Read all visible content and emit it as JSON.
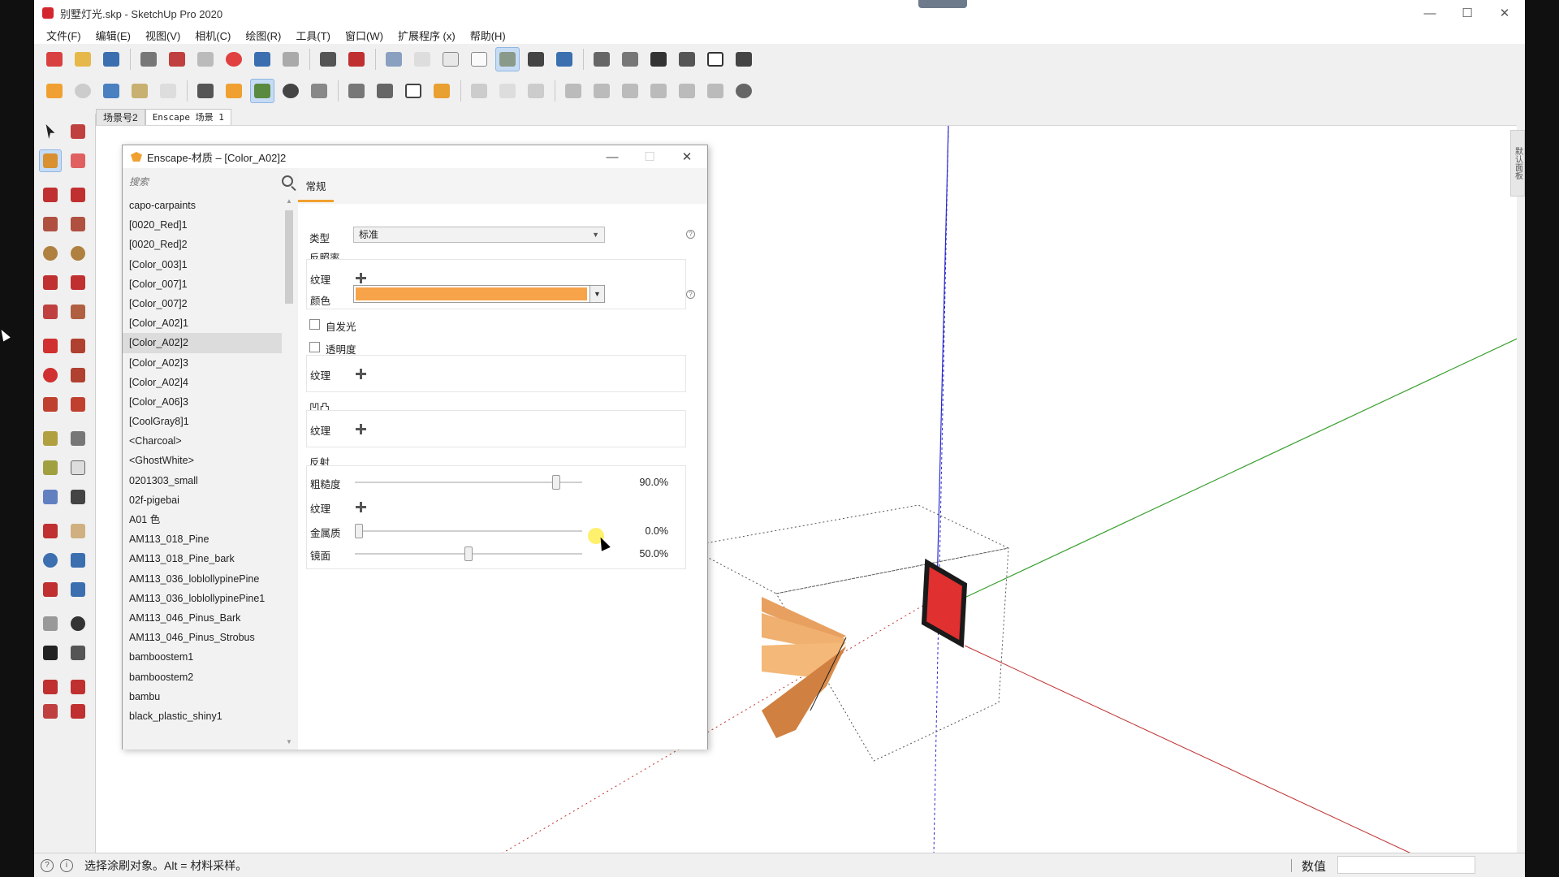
{
  "window": {
    "title": "别墅灯光.skp - SketchUp Pro 2020",
    "minimize_glyph": "—",
    "maximize_glyph": "☐",
    "close_glyph": "✕"
  },
  "menu": [
    "文件(F)",
    "编辑(E)",
    "视图(V)",
    "相机(C)",
    "绘图(R)",
    "工具(T)",
    "窗口(W)",
    "扩展程序 (x)",
    "帮助(H)"
  ],
  "scene_tabs": [
    "场景号2",
    "Enscape 场景 1"
  ],
  "tray_handle_label": "默认面板",
  "dialog": {
    "title": "Enscape-材质 – [Color_A02]2",
    "minimize_glyph": "—",
    "maximize_glyph": "☐",
    "close_glyph": "✕",
    "search_placeholder": "搜索",
    "materials": [
      "capo-carpaints",
      "[0020_Red]1",
      "[0020_Red]2",
      "[Color_003]1",
      "[Color_007]1",
      "[Color_007]2",
      "[Color_A02]1",
      "[Color_A02]2",
      "[Color_A02]3",
      "[Color_A02]4",
      "[Color_A06]3",
      "[CoolGray8]1",
      "<Charcoal>",
      "<GhostWhite>",
      "0201303_small",
      "02f-pigebai",
      "A01 色",
      "AM113_018_Pine",
      "AM113_018_Pine_bark",
      "AM113_036_loblollypinePine",
      "AM113_036_loblollypinePine1",
      "AM113_046_Pinus_Bark",
      "AM113_046_Pinus_Strobus",
      "bamboostem1",
      "bamboostem2",
      "bambu",
      "black_plastic_shiny1"
    ],
    "selected_material": "[Color_A02]2",
    "tab_general": "常规",
    "type_label": "类型",
    "type_value": "标准",
    "albedo_header": "反照率",
    "texture_label": "纹理",
    "color_label": "颜色",
    "albedo_color": "#f7a34a",
    "self_illum_label": "自发光",
    "transparency_label": "透明度",
    "bump_header": "凹凸",
    "reflection_header": "反射",
    "roughness_label": "粗糙度",
    "roughness_value": "90.0%",
    "roughness_fraction": 0.9,
    "metallic_label": "金属质",
    "metallic_value": "0.0%",
    "metallic_fraction": 0.0,
    "specular_label": "镜面",
    "specular_value": "50.0%",
    "specular_fraction": 0.5,
    "help_glyph": "?"
  },
  "status": {
    "text": "选择涂刷对象。Alt = 材料采样。",
    "measure_label": "数值",
    "info_glyph": "i",
    "help_glyph": "?"
  },
  "colors": {
    "accent_orange": "#f0a030",
    "axis_blue": "#2a2ad0",
    "axis_green": "#3aa030",
    "axis_red": "#c03030",
    "light_fixture_red": "#e03030"
  }
}
